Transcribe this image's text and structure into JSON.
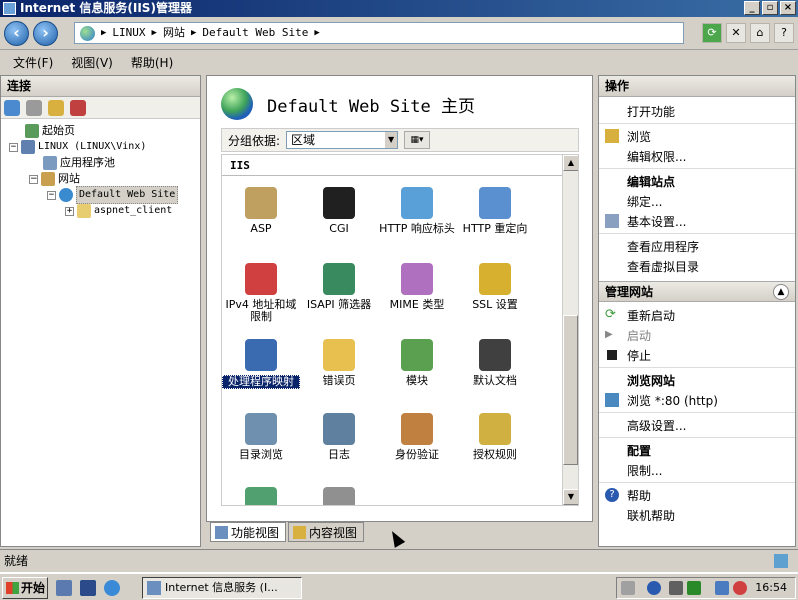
{
  "window": {
    "title": "Internet 信息服务(IIS)管理器",
    "buttons": [
      "_",
      "▫",
      "×"
    ]
  },
  "address": {
    "segments": [
      "LINUX",
      "网站",
      "Default Web Site"
    ]
  },
  "menu": [
    "文件(F)",
    "视图(V)",
    "帮助(H)"
  ],
  "connections": {
    "title": "连接",
    "tree": [
      {
        "label": "起始页"
      },
      {
        "label": "LINUX (LINUX\\Vinx)"
      },
      {
        "label": "应用程序池"
      },
      {
        "label": "网站"
      },
      {
        "label": "Default Web Site"
      },
      {
        "label": "aspnet_client"
      }
    ]
  },
  "center": {
    "title": "Default Web Site 主页",
    "group_label": "分组依据:",
    "group_value": "区域",
    "section": "IIS",
    "features": [
      {
        "label": "ASP",
        "icon": "asp-icon",
        "color": "#c0a060"
      },
      {
        "label": "CGI",
        "icon": "cgi-icon",
        "color": "#202020"
      },
      {
        "label": "HTTP 响应标头",
        "icon": "http-response-headers-icon",
        "color": "#5aa0d8"
      },
      {
        "label": "HTTP 重定向",
        "icon": "http-redirect-icon",
        "color": "#5a8fd0"
      },
      {
        "label": "IPv4 地址和域限制",
        "icon": "ipv4-restriction-icon",
        "color": "#d04040"
      },
      {
        "label": "ISAPI 筛选器",
        "icon": "isapi-filter-icon",
        "color": "#3a8a60"
      },
      {
        "label": "MIME 类型",
        "icon": "mime-types-icon",
        "color": "#b070c0"
      },
      {
        "label": "SSL 设置",
        "icon": "ssl-lock-icon",
        "color": "#d8b030"
      },
      {
        "label": "处理程序映射",
        "icon": "handler-mappings-icon",
        "color": "#3a6ab0"
      },
      {
        "label": "错误页",
        "icon": "error-pages-icon",
        "color": "#e8c050"
      },
      {
        "label": "模块",
        "icon": "modules-icon",
        "color": "#5aa050"
      },
      {
        "label": "默认文档",
        "icon": "default-document-icon",
        "color": "#404040"
      },
      {
        "label": "目录浏览",
        "icon": "directory-browsing-icon",
        "color": "#7090b0"
      },
      {
        "label": "日志",
        "icon": "logging-icon",
        "color": "#6080a0"
      },
      {
        "label": "身份验证",
        "icon": "authentication-icon",
        "color": "#c08040"
      },
      {
        "label": "授权规则",
        "icon": "authorization-rules-icon",
        "color": "#d0b040"
      },
      {
        "label": "",
        "icon": "output-caching-icon",
        "color": "#50a070"
      },
      {
        "label": "",
        "icon": "request-filtering-icon",
        "color": "#909090"
      }
    ],
    "view_tabs": [
      "功能视图",
      "内容视图"
    ]
  },
  "actions": {
    "title": "操作",
    "open_feature": "打开功能",
    "browse": "浏览",
    "edit_permissions": "编辑权限...",
    "edit_site_heading": "编辑站点",
    "bindings": "绑定...",
    "basic_settings": "基本设置...",
    "view_applications": "查看应用程序",
    "view_virtual_dirs": "查看虚拟目录",
    "manage_site_heading": "管理网站",
    "restart": "重新启动",
    "start": "启动",
    "stop": "停止",
    "browse_site_heading": "浏览网站",
    "browse_port": "浏览 *:80 (http)",
    "advanced_settings": "高级设置...",
    "config_heading": "配置",
    "limits": "限制...",
    "help": "帮助",
    "online_help": "联机帮助"
  },
  "status": {
    "text": "就绪"
  },
  "taskbar": {
    "start": "开始",
    "task": "Internet 信息服务 (I...",
    "clock": "16:54"
  }
}
